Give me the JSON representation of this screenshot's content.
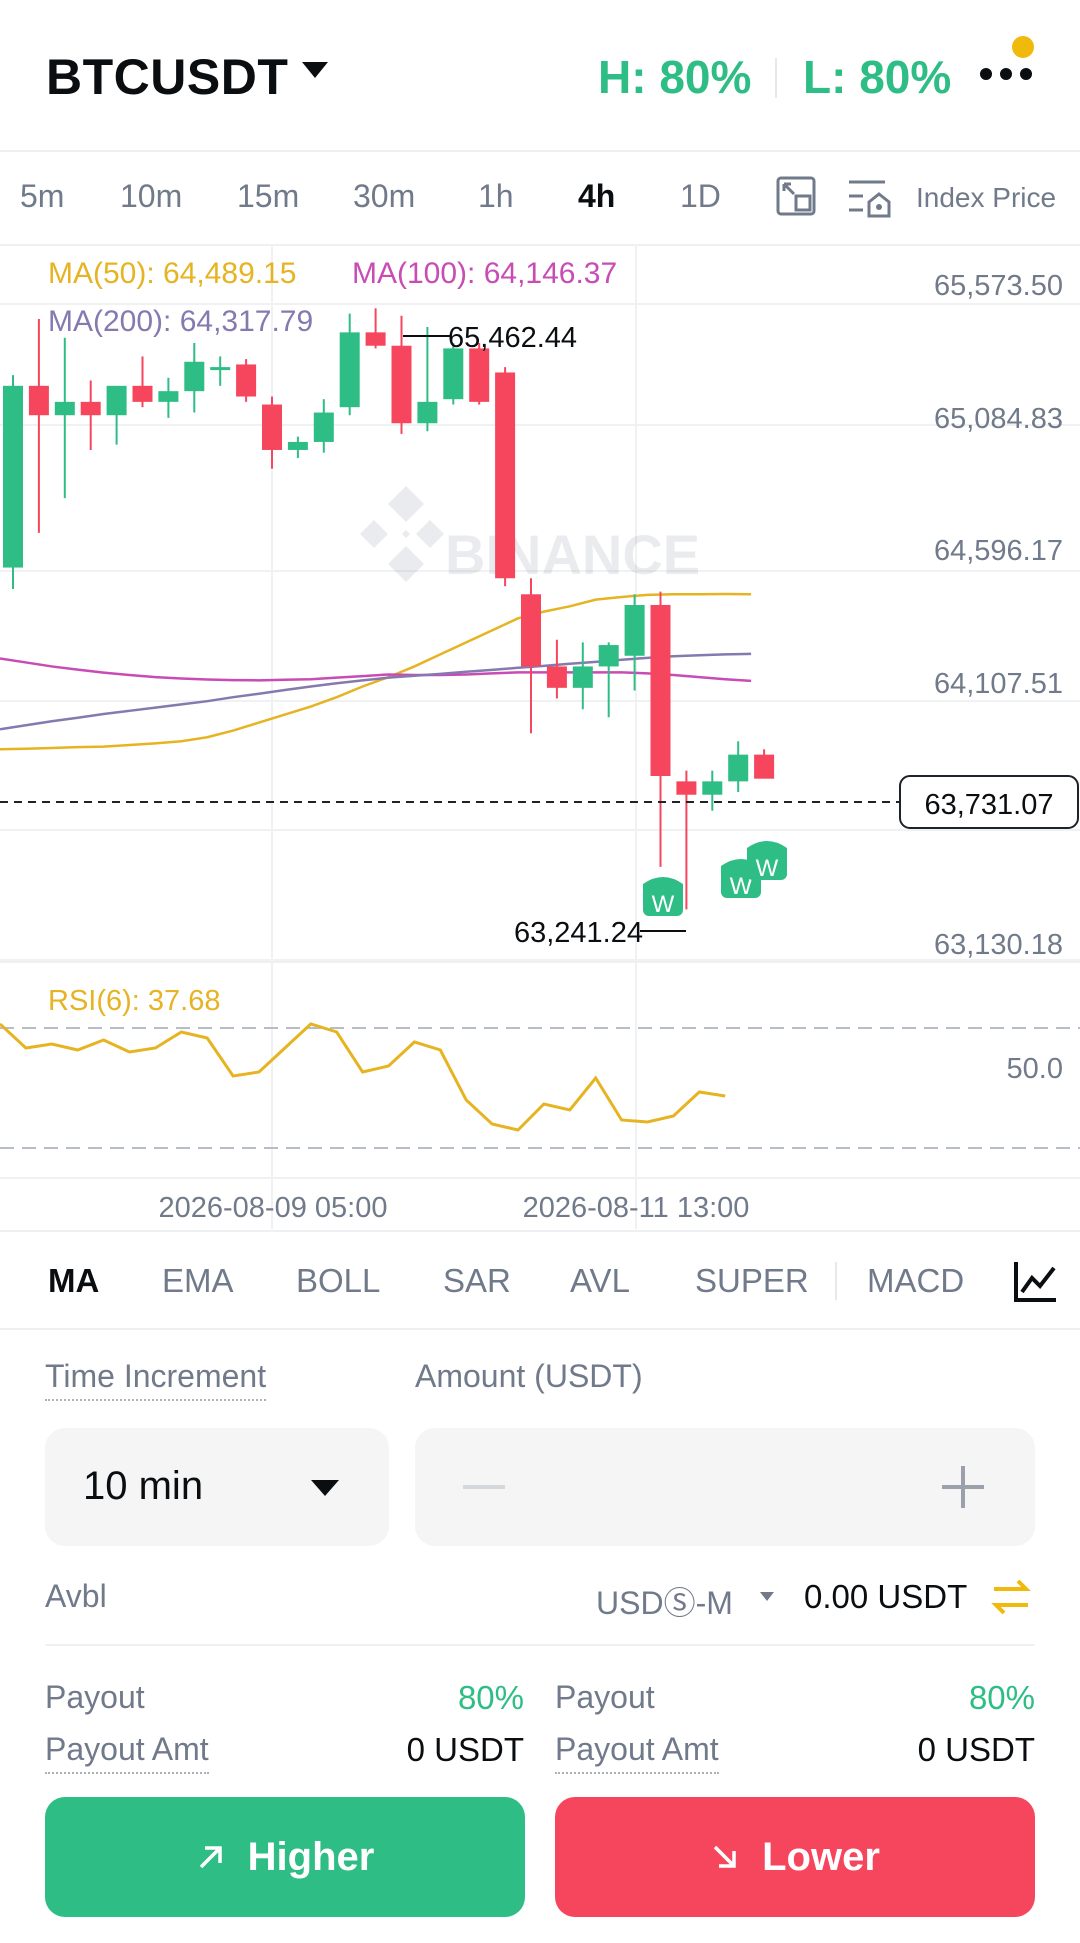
{
  "header": {
    "symbol": "BTCUSDT",
    "high_rate": "H: 80%",
    "low_rate": "L: 80%",
    "accent_green": "#2ebd85",
    "accent_red": "#f6465d",
    "notification_color": "#f0b90b"
  },
  "intervals": [
    "5m",
    "10m",
    "15m",
    "30m",
    "1h",
    "4h",
    "1D"
  ],
  "active_interval": "4h",
  "index_price_label": "Index Price",
  "chart": {
    "ma50": "MA(50): 64,489.15",
    "ma100": "MA(100): 64,146.37",
    "ma200": "MA(200): 64,317.79",
    "price_ticks": [
      "65,573.50",
      "65,084.83",
      "64,596.17",
      "64,107.51",
      "63,130.18"
    ],
    "current_price": "63,731.07",
    "high_label": "65,462.44",
    "low_label": "63,241.24",
    "watermark": "BINANCE",
    "rsi_label": "RSI(6): 37.68",
    "rsi_level": "50.0",
    "date_labels": [
      "2026-08-09 05:00",
      "2026-08-11 13:00"
    ],
    "w_marker": "W"
  },
  "chart_data": {
    "type": "candlestick",
    "y_ticks": [
      65573.5,
      65084.83,
      64596.17,
      64107.51,
      63130.18
    ],
    "current_price": 63731.07,
    "visible_high": 65462.44,
    "visible_low": 63241.24,
    "candles": [
      {
        "o": 64520,
        "h": 65240,
        "l": 64440,
        "c": 65200
      },
      {
        "o": 65200,
        "h": 65450,
        "l": 64650,
        "c": 65090
      },
      {
        "o": 65090,
        "h": 65380,
        "l": 64780,
        "c": 65140
      },
      {
        "o": 65140,
        "h": 65220,
        "l": 64960,
        "c": 65090
      },
      {
        "o": 65090,
        "h": 65190,
        "l": 64980,
        "c": 65200
      },
      {
        "o": 65200,
        "h": 65310,
        "l": 65120,
        "c": 65140
      },
      {
        "o": 65140,
        "h": 65230,
        "l": 65080,
        "c": 65180
      },
      {
        "o": 65180,
        "h": 65360,
        "l": 65100,
        "c": 65290
      },
      {
        "o": 65260,
        "h": 65310,
        "l": 65200,
        "c": 65270
      },
      {
        "o": 65280,
        "h": 65300,
        "l": 65140,
        "c": 65160
      },
      {
        "o": 65130,
        "h": 65160,
        "l": 64890,
        "c": 64960
      },
      {
        "o": 64960,
        "h": 65010,
        "l": 64930,
        "c": 64990
      },
      {
        "o": 64990,
        "h": 65150,
        "l": 64950,
        "c": 65100
      },
      {
        "o": 65120,
        "h": 65470,
        "l": 65090,
        "c": 65400
      },
      {
        "o": 65400,
        "h": 65490,
        "l": 65340,
        "c": 65350
      },
      {
        "o": 65350,
        "h": 65462,
        "l": 65020,
        "c": 65060
      },
      {
        "o": 65060,
        "h": 65420,
        "l": 65030,
        "c": 65140
      },
      {
        "o": 65150,
        "h": 65360,
        "l": 65130,
        "c": 65340
      },
      {
        "o": 65340,
        "h": 65360,
        "l": 65130,
        "c": 65140
      },
      {
        "o": 65250,
        "h": 65270,
        "l": 64450,
        "c": 64480
      },
      {
        "o": 64420,
        "h": 64480,
        "l": 63900,
        "c": 64150
      },
      {
        "o": 64150,
        "h": 64250,
        "l": 64030,
        "c": 64070
      },
      {
        "o": 64070,
        "h": 64240,
        "l": 63990,
        "c": 64150
      },
      {
        "o": 64150,
        "h": 64240,
        "l": 63960,
        "c": 64230
      },
      {
        "o": 64190,
        "h": 64420,
        "l": 64060,
        "c": 64380
      },
      {
        "o": 64380,
        "h": 64430,
        "l": 63400,
        "c": 63740
      },
      {
        "o": 63720,
        "h": 63760,
        "l": 63241,
        "c": 63670
      },
      {
        "o": 63670,
        "h": 63760,
        "l": 63610,
        "c": 63720
      },
      {
        "o": 63720,
        "h": 63870,
        "l": 63680,
        "c": 63820
      },
      {
        "o": 63820,
        "h": 63840,
        "l": 63740,
        "c": 63730
      }
    ],
    "ma_series": [
      {
        "name": "MA(50)",
        "color": "#e6b422",
        "values": [
          63840,
          63842,
          63845,
          63848,
          63850,
          63856,
          63862,
          63870,
          63885,
          63910,
          63940,
          63970,
          64000,
          64035,
          64075,
          64110,
          64150,
          64195,
          64240,
          64285,
          64330,
          64355,
          64375,
          64400,
          64410,
          64418,
          64420,
          64420,
          64421,
          64420
        ]
      },
      {
        "name": "MA(100)",
        "color": "#c94bb4",
        "values": [
          64180,
          64165,
          64150,
          64138,
          64127,
          64118,
          64110,
          64105,
          64101,
          64099,
          64098,
          64100,
          64102,
          64108,
          64114,
          64120,
          64118,
          64118,
          64120,
          64124,
          64128,
          64128,
          64128,
          64128,
          64128,
          64124,
          64118,
          64110,
          64102,
          64096
        ]
      },
      {
        "name": "MA(200)",
        "color": "#8579b0",
        "values": [
          63915,
          63930,
          63945,
          63958,
          63972,
          63984,
          63996,
          64008,
          64020,
          64035,
          64048,
          64062,
          64075,
          64087,
          64098,
          64108,
          64115,
          64122,
          64130,
          64137,
          64145,
          64152,
          64160,
          64167,
          64175,
          64182,
          64188,
          64192,
          64195,
          64197
        ]
      }
    ],
    "rsi_series": [
      82,
      70,
      72,
      69,
      74,
      68,
      70,
      78,
      75,
      56,
      58,
      70,
      82,
      78,
      58,
      61,
      73,
      69,
      44,
      32,
      29,
      42,
      39,
      55,
      34,
      33,
      36,
      48,
      46
    ]
  },
  "indicator_tabs": [
    "MA",
    "EMA",
    "BOLL",
    "SAR",
    "AVL",
    "SUPER",
    "MACD"
  ],
  "active_indicator": "MA",
  "form": {
    "time_increment_label": "Time Increment",
    "time_increment_value": "10 min",
    "amount_label": "Amount (USDT)",
    "avbl_label": "Avbl",
    "account_type": "USDⓈ-M",
    "avbl_value": "0.00 USDT",
    "left": {
      "payout_label": "Payout",
      "payout_rate": "80%",
      "payout_amt_label": "Payout Amt",
      "payout_amt": "0 USDT"
    },
    "right": {
      "payout_label": "Payout",
      "payout_rate": "80%",
      "payout_amt_label": "Payout Amt",
      "payout_amt": "0 USDT"
    },
    "higher_label": "Higher",
    "lower_label": "Lower"
  }
}
